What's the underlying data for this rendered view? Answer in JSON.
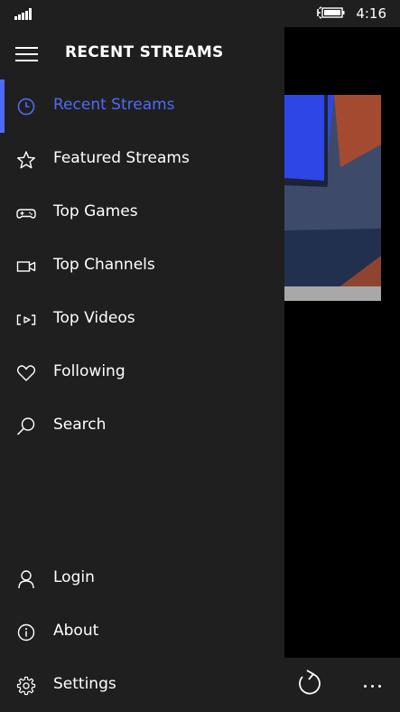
{
  "status_bar": {
    "time": "4:16"
  },
  "header": {
    "title": "RECENT STREAMS"
  },
  "nav": {
    "accent_color": "#4f6bf6",
    "items": [
      {
        "label": "Recent Streams",
        "icon": "clock-icon",
        "active": true
      },
      {
        "label": "Featured Streams",
        "icon": "star-icon",
        "active": false
      },
      {
        "label": "Top Games",
        "icon": "gamepad-icon",
        "active": false
      },
      {
        "label": "Top Channels",
        "icon": "video-camera-icon",
        "active": false
      },
      {
        "label": "Top Videos",
        "icon": "video-screen-icon",
        "active": false
      },
      {
        "label": "Following",
        "icon": "heart-icon",
        "active": false
      },
      {
        "label": "Search",
        "icon": "search-icon",
        "active": false
      }
    ],
    "bottom_items": [
      {
        "label": "Login",
        "icon": "person-icon"
      },
      {
        "label": "About",
        "icon": "info-icon"
      },
      {
        "label": "Settings",
        "icon": "gear-icon"
      }
    ]
  },
  "app_bar": {
    "refresh_icon": "refresh-icon",
    "more_icon": "more-icon"
  }
}
